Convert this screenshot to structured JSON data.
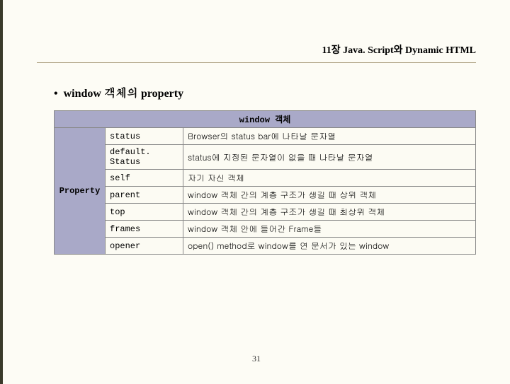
{
  "header": "11장 Java. Script와 Dynamic HTML",
  "bullet_title": "window 객체의 property",
  "table": {
    "title": "window 객체",
    "row_header": "Property",
    "rows": [
      {
        "name": "status",
        "desc": "Browser의 status bar에 나타날 문자열"
      },
      {
        "name": "default. Status",
        "desc": "status에 지정된 문자열이 없을 때 나타날 문자열"
      },
      {
        "name": "self",
        "desc": "자기 자신 객체"
      },
      {
        "name": "parent",
        "desc": "window 객체 간의 계층 구조가 생길 때 상위 객체"
      },
      {
        "name": "top",
        "desc": "window 객체 간의 계층 구조가 생길 때 최상위 객체"
      },
      {
        "name": "frames",
        "desc": "window 객체 안에 들어간 Frame들"
      },
      {
        "name": "opener",
        "desc": "open() method로 window를 연 문서가 있는 window"
      }
    ]
  },
  "page_number": "31"
}
